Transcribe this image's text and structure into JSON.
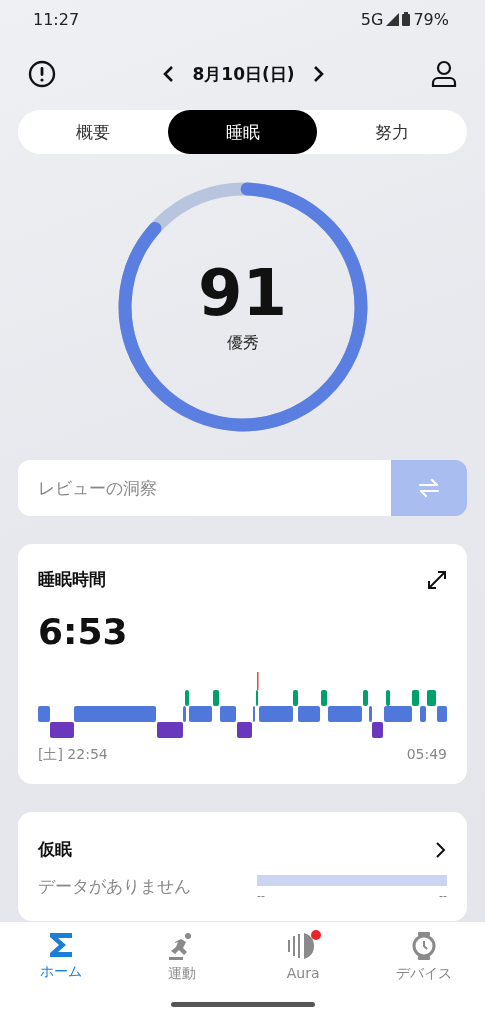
{
  "status_bar": {
    "time": "11:27",
    "network": "5G",
    "battery": "79%"
  },
  "header": {
    "date": "8月10日(日)"
  },
  "tabs": [
    {
      "label": "概要",
      "selected": false
    },
    {
      "label": "睡眠",
      "selected": true
    },
    {
      "label": "努力",
      "selected": false
    }
  ],
  "score": {
    "value": "91",
    "rating": "優秀",
    "level": 0.86
  },
  "insight": {
    "placeholder": "レビューの洞察"
  },
  "sleep_card": {
    "title": "睡眠時間",
    "duration": "6:53",
    "start": "[土] 22:54",
    "end": "05:49"
  },
  "nap_card": {
    "title": "仮眠",
    "message": "データがありません",
    "start": "--",
    "end": "--"
  },
  "nav": [
    {
      "label": "ホーム",
      "selected": true,
      "kind": "home"
    },
    {
      "label": "運動",
      "selected": false,
      "kind": "exercise"
    },
    {
      "label": "Aura",
      "selected": false,
      "kind": "aura",
      "badge": true
    },
    {
      "label": "デバイス",
      "selected": false,
      "kind": "device"
    }
  ]
}
